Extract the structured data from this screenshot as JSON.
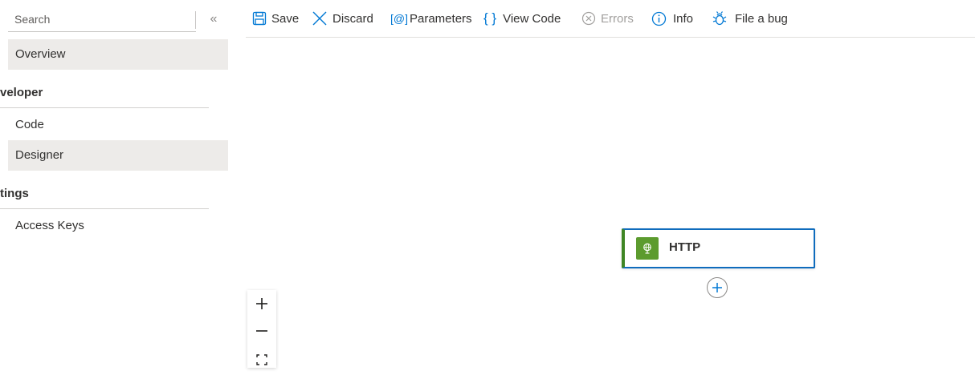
{
  "sidebar": {
    "search_placeholder": "Search",
    "collapse_glyph": "«",
    "items": [
      {
        "label": "Overview",
        "selected": true,
        "icon": "none"
      },
      {
        "section": "veloper"
      },
      {
        "label": "Code",
        "selected": false
      },
      {
        "label": "Designer",
        "selected": true
      },
      {
        "section": "tings"
      },
      {
        "label": "Access Keys",
        "selected": false
      }
    ]
  },
  "toolbar": {
    "save_label": "Save",
    "discard_label": "Discard",
    "parameters_label": "Parameters",
    "parameters_glyph": "[@]",
    "view_code_label": "View Code",
    "view_code_glyph": "{ }",
    "errors_label": "Errors",
    "info_label": "Info",
    "file_bug_label": "File a bug"
  },
  "canvas": {
    "node": {
      "title": "HTTP",
      "icon": "http-globe-icon",
      "accent_color": "#5c9b2e"
    },
    "add_step_icon": "plus-circle-icon",
    "zoom": {
      "in": "+",
      "out": "−",
      "fit": "fit-view-icon"
    }
  },
  "colors": {
    "accent": "#0078d4",
    "selected_bg": "#edebe9",
    "node_border": "#0f6cbd",
    "node_icon_bg": "#5c9b2e",
    "disabled": "#a19f9d"
  }
}
